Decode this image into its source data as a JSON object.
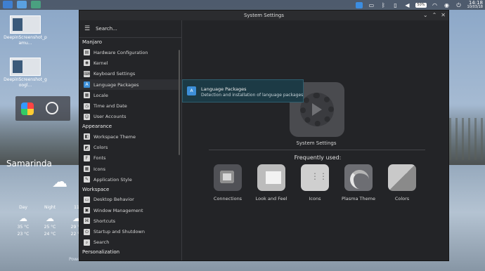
{
  "desktop": {
    "icons": [
      {
        "label": "DeepinScreenshot_p\namu..."
      },
      {
        "label": "DeepinScreenshot_g\noogl..."
      }
    ]
  },
  "panel": {
    "time": "14:18",
    "date": "10/03/18",
    "battery_percent": "50%"
  },
  "weather": {
    "city": "Samarinda",
    "current_temp": "",
    "columns": [
      {
        "label": "Day",
        "high": "35 °C",
        "low": "23 °C"
      },
      {
        "label": "Night",
        "high": "25 °C",
        "low": "24 °C"
      },
      {
        "label": "11",
        "high": "29 °C",
        "low": "22 °C"
      }
    ],
    "powered": "Powe"
  },
  "window": {
    "title": "System Settings",
    "search_placeholder": "Search...",
    "groups": [
      {
        "name": "Manjaro",
        "items": [
          "Hardware Configuration",
          "Kernel",
          "Keyboard Settings",
          "Language Packages",
          "Locale",
          "Time and Date",
          "User Accounts"
        ]
      },
      {
        "name": "Appearance",
        "items": [
          "Workspace Theme",
          "Colors",
          "Fonts",
          "Icons",
          "Application Style"
        ]
      },
      {
        "name": "Workspace",
        "items": [
          "Desktop Behavior",
          "Window Management",
          "Shortcuts",
          "Startup and Shutdown",
          "Search"
        ]
      },
      {
        "name": "Personalization",
        "items": []
      }
    ],
    "main_title": "System Settings",
    "frequently_used": "Frequently used:",
    "tiles": [
      "Connections",
      "Look and Feel",
      "Icons",
      "Plasma Theme",
      "Colors"
    ],
    "tooltip": {
      "title": "Language Packages",
      "subtitle": "Detection and installation of language packages"
    }
  }
}
